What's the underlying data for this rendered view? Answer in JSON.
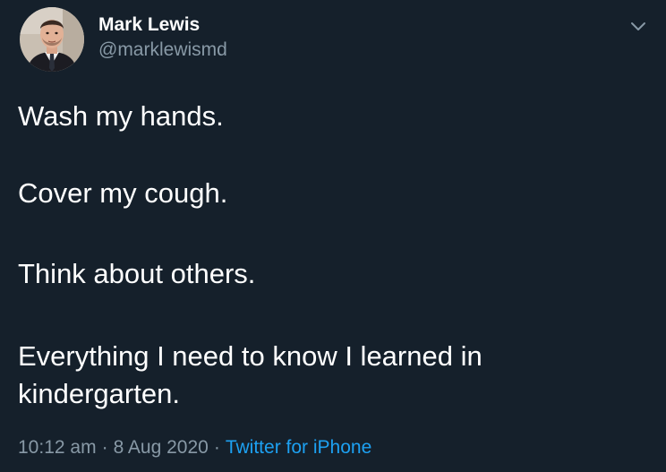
{
  "author": {
    "display_name": "Mark Lewis",
    "handle": "@marklewismd",
    "avatar_icon": "profile-photo"
  },
  "header": {
    "menu_icon": "chevron-down-icon"
  },
  "tweet": {
    "lines": [
      "Wash my hands.",
      "Cover my cough.",
      "Think about others.",
      "Everything I need to know I learned in",
      "kindergarten."
    ]
  },
  "meta": {
    "time": "10:12 am",
    "separator": "·",
    "date": "8 Aug 2020",
    "source": "Twitter for iPhone"
  },
  "colors": {
    "background": "#15202b",
    "text": "#ffffff",
    "secondary_text": "#8899a6",
    "link": "#1da1f2"
  }
}
